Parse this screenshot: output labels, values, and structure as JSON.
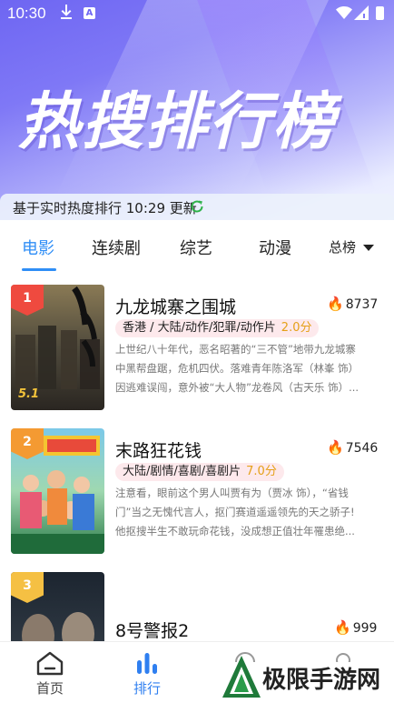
{
  "status_bar": {
    "time": "10:30",
    "a_badge": "A"
  },
  "hero": {
    "title": "热搜排行榜"
  },
  "update_bar": {
    "text": "基于实时热度排行 10:29 更新"
  },
  "tabs": [
    "电影",
    "连续剧",
    "综艺",
    "动漫"
  ],
  "active_tab": "电影",
  "sort_label": "总榜",
  "items": [
    {
      "rank": "1",
      "title": "九龙城寨之围城",
      "heat": "8737",
      "tags": "香港 / 大陆/动作/犯罪/动作片",
      "score": "2.0分",
      "desc": [
        "上世纪八十年代，恶名昭著的“三不管”地带九龙城寨",
        "中黑帮盘踞，危机四伏。落难青年陈洛军（林峯 饰）",
        "因逃难误闯，意外被“大人物”龙卷风（古天乐 饰）..."
      ]
    },
    {
      "rank": "2",
      "title": "末路狂花钱",
      "heat": "7546",
      "tags": "大陆/剧情/喜剧/喜剧片",
      "score": "7.0分",
      "desc": [
        "注意看，眼前这个男人叫贾有为（贾冰 饰），“省钱",
        "门”当之无愧代言人，抠门赛道遥遥领先的天之骄子!",
        "他抠搜半生不敢玩命花钱，没成想正值壮年罹患绝..."
      ]
    },
    {
      "rank": "3",
      "title": "8号警报2",
      "heat": "999"
    }
  ],
  "bottom_nav": [
    "首页",
    "排行"
  ],
  "active_nav": "排行",
  "watermark": "极限手游网",
  "colors": {
    "accent": "#2f8ef6",
    "rank1": "#ef4a3f",
    "rank2": "#f49a32",
    "rank3": "#f5c043",
    "score": "#e5a018",
    "flame": "#ee3b2f"
  }
}
